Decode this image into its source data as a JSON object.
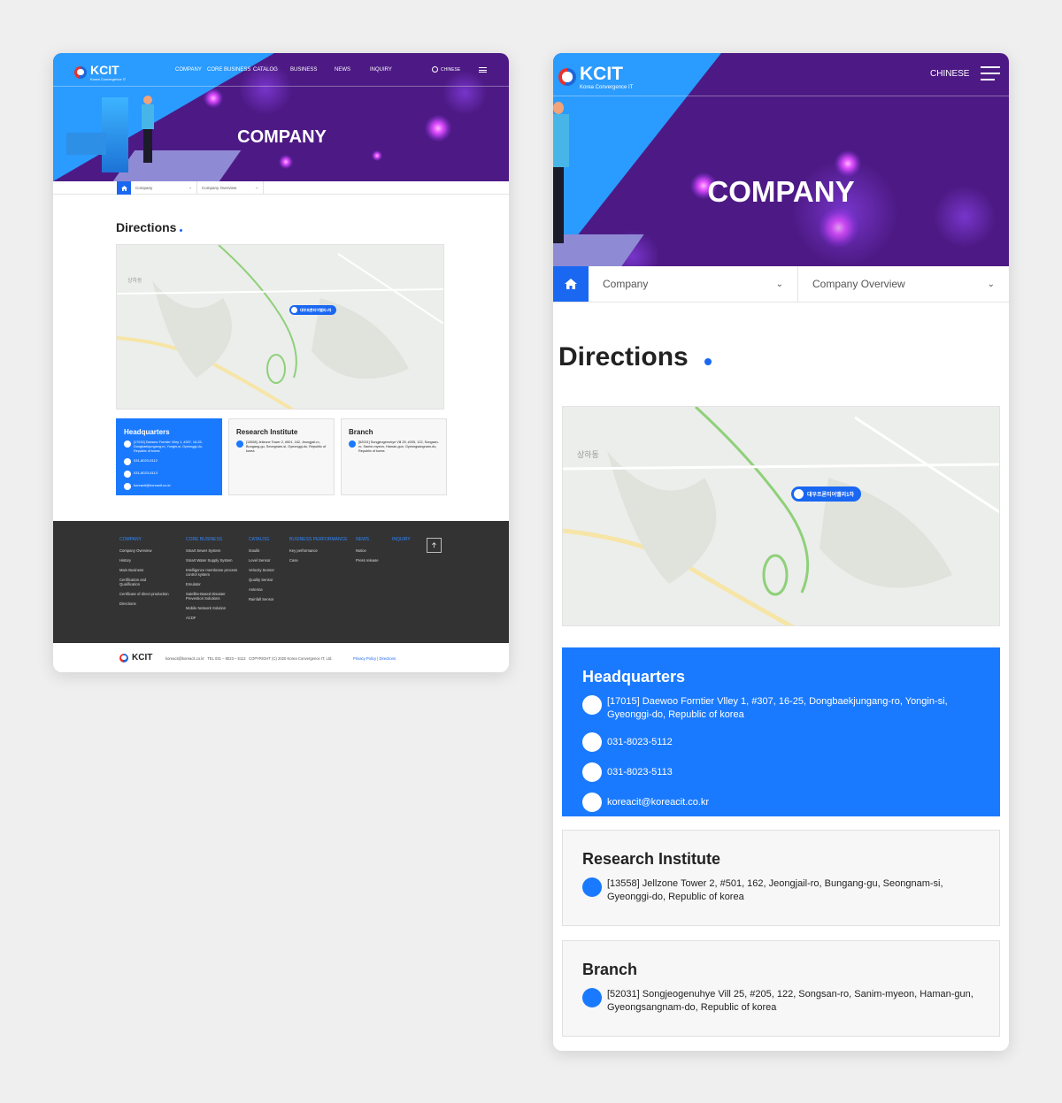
{
  "brand": {
    "name": "KCIT",
    "tagline": "Korea Convergence IT"
  },
  "nav": [
    "COMPANY",
    "CORE BUSINESS",
    "CATALOG",
    "BUSINESS",
    "NEWS",
    "INQUIRY"
  ],
  "lang": "CHINESE",
  "hero_title": "COMPANY",
  "breadcrumb": {
    "level1": "Company",
    "level2": "Company Overview"
  },
  "heading": "Directions",
  "map": {
    "pin_label": "대우프론티어밸리1차",
    "place_labels": [
      "상하동"
    ]
  },
  "offices": {
    "hq": {
      "title": "Headquarters",
      "address": "[17015] Daewoo Forntier Vlley 1, #307, 16-25, Dongbaekjungang-ro, Yongin-si, Gyeonggi-do, Republic of korea",
      "tel": "031-8023-5112",
      "fax": "031-8023-5113",
      "email": "koreacit@koreacit.co.kr"
    },
    "research": {
      "title": "Research Institute",
      "address": "[13558] Jellzone Tower 2, #501, 162, Jeongjail-ro, Bungang-gu, Seongnam-si, Gyeonggi-do, Republic of korea"
    },
    "branch": {
      "title": "Branch",
      "address": "[52031] Songjeogenuhye Vill 25, #205, 122, Songsan-ro, Sanim-myeon, Haman-gun, Gyeongsangnam-do, Republic of korea"
    }
  },
  "footer": {
    "columns": [
      {
        "head": "COMPANY",
        "items": [
          "Company Overview",
          "History",
          "Main Business",
          "Certification and Qualification",
          "Certificate of direct production",
          "Directions"
        ]
      },
      {
        "head": "CORE BUSINESS",
        "items": [
          "Smart Sewer System",
          "Smart Water Supply System",
          "Intelligence membrane process control system",
          "Emulator",
          "Satellite-Based Disaster Prevention Solutions",
          "Mobile Network Solution",
          "ACDF"
        ]
      },
      {
        "head": "CATALOG",
        "items": [
          "iSoulik",
          "Level Sensor",
          "Velocity Sensor",
          "Quality Sensor",
          "Antenna",
          "Rainfall Sensor"
        ]
      },
      {
        "head": "BUSINESS PERFORMANCE",
        "items": [
          "Key performance",
          "Case"
        ]
      },
      {
        "head": "NEWS",
        "items": [
          "Notice",
          "Press release"
        ]
      },
      {
        "head": "INQUIRY",
        "items": []
      }
    ],
    "bottom": {
      "email": "koreacit@koreacit.co.kr",
      "tel": "TEL 031 – 8023 – 5112",
      "copyright": "COPYRIGHT (C) 2020 Korea Convergence IT, Ltd.",
      "privacy": "Privacy Policy",
      "directions": "Directions"
    }
  },
  "colors": {
    "accent": "#1a67f2",
    "hq_bg": "#1a7aff",
    "hero": "#4d1a85",
    "footer": "#333333"
  }
}
